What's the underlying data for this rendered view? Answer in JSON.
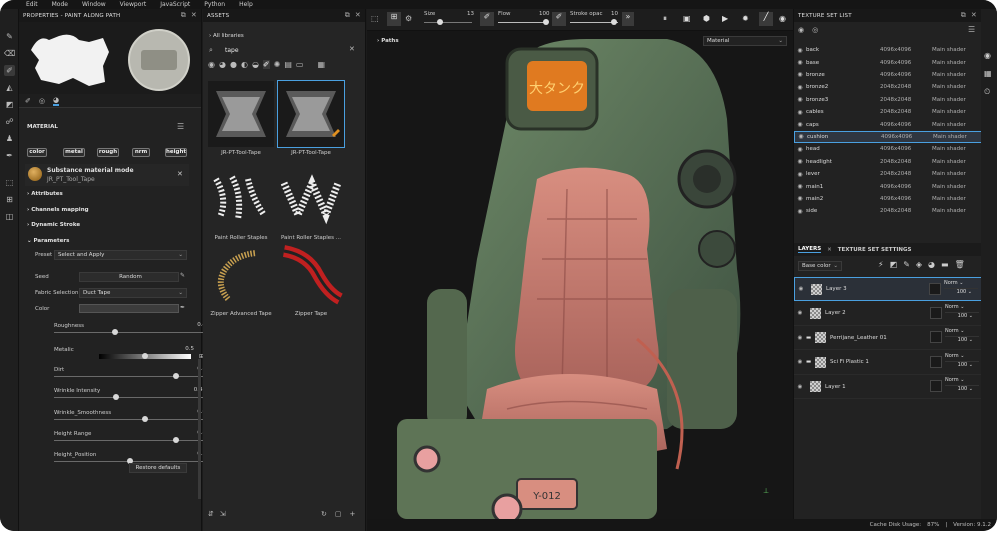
{
  "menu": [
    "Edit",
    "Mode",
    "Window",
    "Viewport",
    "JavaScript",
    "Python",
    "Help"
  ],
  "properties": {
    "title": "PROPERTIES - PAINT ALONG PATH",
    "section_material": "MATERIAL",
    "chips": [
      "color",
      "metal",
      "rough",
      "nrm",
      "height"
    ],
    "substance_mode": "Substance material mode",
    "substance_name": "JR_PT_Tool_Tape",
    "sections": [
      "Attributes",
      "Channels mapping",
      "Dynamic Stroke",
      "Parameters"
    ],
    "preset_label": "Preset",
    "preset_value": "Select and Apply",
    "seed_label": "Seed",
    "seed_value": "Random",
    "fabric_label": "Fabric Selection",
    "fabric_value": "Duct Tape",
    "color_label": "Color",
    "sliders": [
      {
        "label": "Roughness",
        "value": "0.4",
        "fraction": 0.4
      },
      {
        "label": "Metalic",
        "value": "0.5",
        "fraction": 0.5
      },
      {
        "label": "Dirt",
        "value": "0.8",
        "fraction": 0.8
      },
      {
        "label": "Wrinkle Intensity",
        "value": "0.41",
        "fraction": 0.41
      },
      {
        "label": "Wrinkle_Smoothness",
        "value": "0.6",
        "fraction": 0.6
      },
      {
        "label": "Height Range",
        "value": "0.8",
        "fraction": 0.8
      },
      {
        "label": "Height_Position",
        "value": "0.5",
        "fraction": 0.5
      }
    ],
    "restore": "Restore defaults"
  },
  "assets": {
    "title": "ASSETS",
    "all_libraries": "All libraries",
    "search_value": "tape",
    "items": [
      {
        "name": "JR-PT-Tool-Tape",
        "selected": false
      },
      {
        "name": "JR-PT-Tool-Tape",
        "selected": true
      },
      {
        "name": "Paint Roller Staples",
        "selected": false
      },
      {
        "name": "Paint Roller Staples ...",
        "selected": false
      },
      {
        "name": "Zipper Advanced Tape",
        "selected": false
      },
      {
        "name": "Zipper Tape",
        "selected": false
      }
    ]
  },
  "toolbar": {
    "size_label": "Size",
    "size_value": "13",
    "flow_label": "Flow",
    "flow_value": "100",
    "stroke_label": "Stroke opac",
    "stroke_value": "10"
  },
  "viewport": {
    "paths_label": "Paths",
    "material_dropdown": "Material",
    "screen_sign": "大タンク",
    "plate_text": "Y-012"
  },
  "texture_set": {
    "title": "TEXTURE SET LIST",
    "rows": [
      {
        "name": "back",
        "res": "4096x4096",
        "shader": "Main shader"
      },
      {
        "name": "base",
        "res": "4096x4096",
        "shader": "Main shader"
      },
      {
        "name": "bronze",
        "res": "4096x4096",
        "shader": "Main shader"
      },
      {
        "name": "bronze2",
        "res": "2048x2048",
        "shader": "Main shader"
      },
      {
        "name": "bronze3",
        "res": "2048x2048",
        "shader": "Main shader"
      },
      {
        "name": "cables",
        "res": "2048x2048",
        "shader": "Main shader"
      },
      {
        "name": "caps",
        "res": "4096x4096",
        "shader": "Main shader"
      },
      {
        "name": "cushion",
        "res": "4096x4096",
        "shader": "Main shader",
        "selected": true
      },
      {
        "name": "head",
        "res": "4096x4096",
        "shader": "Main shader"
      },
      {
        "name": "headlight",
        "res": "2048x2048",
        "shader": "Main shader"
      },
      {
        "name": "lever",
        "res": "2048x2048",
        "shader": "Main shader"
      },
      {
        "name": "main1",
        "res": "4096x4096",
        "shader": "Main shader"
      },
      {
        "name": "main2",
        "res": "4096x4096",
        "shader": "Main shader"
      },
      {
        "name": "side",
        "res": "2048x2048",
        "shader": "Main shader"
      }
    ]
  },
  "layers": {
    "tab_layers": "LAYERS",
    "tab_settings": "TEXTURE SET SETTINGS",
    "channel": "Base color",
    "items": [
      {
        "name": "Layer 3",
        "blend": "Norm",
        "opacity": "100",
        "selected": true,
        "folder": false
      },
      {
        "name": "Layer 2",
        "blend": "Norm",
        "opacity": "100",
        "selected": false,
        "folder": false
      },
      {
        "name": "Perrijane_Leather 01",
        "blend": "Norm",
        "opacity": "100",
        "selected": false,
        "folder": true
      },
      {
        "name": "Sci Fi Plastic 1",
        "blend": "Norm",
        "opacity": "100",
        "selected": false,
        "folder": true
      },
      {
        "name": "Layer 1",
        "blend": "Norm",
        "opacity": "100",
        "selected": false,
        "folder": false
      }
    ]
  },
  "status": {
    "cache_label": "Cache Disk Usage:",
    "cache_value": "87%",
    "version": "Version: 9.1.2"
  },
  "colors": {
    "accent": "#4aa0e0",
    "panel": "#222222",
    "bg": "#1b1b1b"
  }
}
